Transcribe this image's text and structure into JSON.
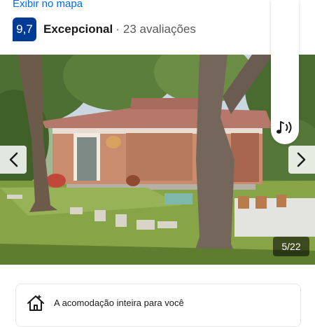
{
  "header": {
    "map_link": "Exibir no mapa",
    "score": "9,7",
    "rating_label": "Excepcional",
    "separator": "·",
    "review_count": "23 avaliações"
  },
  "gallery": {
    "counter": "5/22",
    "current": 5,
    "total": 22,
    "prev_icon": "chevron-left-icon",
    "next_icon": "chevron-right-icon",
    "audio_icon": "audio-icon"
  },
  "feature": {
    "icon": "house-icon",
    "text": "A acomodação inteira para você"
  },
  "colors": {
    "score_badge": "#003b95",
    "link": "#006ce4",
    "text": "#1a1a1a",
    "muted": "#595959"
  }
}
